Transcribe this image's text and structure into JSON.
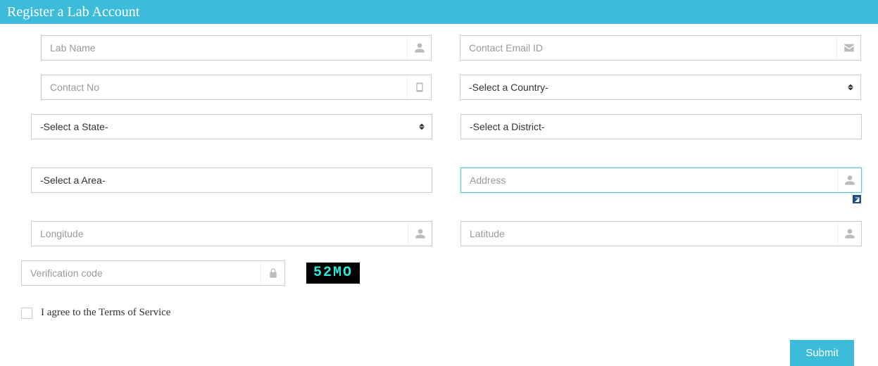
{
  "header": {
    "title": "Register a Lab Account"
  },
  "fields": {
    "lab_name": {
      "placeholder": "Lab Name"
    },
    "contact_email": {
      "placeholder": "Contact Email ID"
    },
    "contact_no": {
      "placeholder": "Contact No"
    },
    "country": {
      "selected": "-Select a Country-"
    },
    "state": {
      "selected": "-Select a State-"
    },
    "district": {
      "selected": "-Select a District-"
    },
    "area": {
      "selected": "-Select a Area-"
    },
    "address": {
      "placeholder": "Address"
    },
    "longitude": {
      "placeholder": "Longitude"
    },
    "latitude": {
      "placeholder": "Latitude"
    },
    "verification": {
      "placeholder": "Verification code"
    }
  },
  "captcha": {
    "text": "52MO"
  },
  "terms": {
    "label": "I agree to the Terms of Service",
    "checked": false
  },
  "buttons": {
    "submit": "Submit"
  }
}
